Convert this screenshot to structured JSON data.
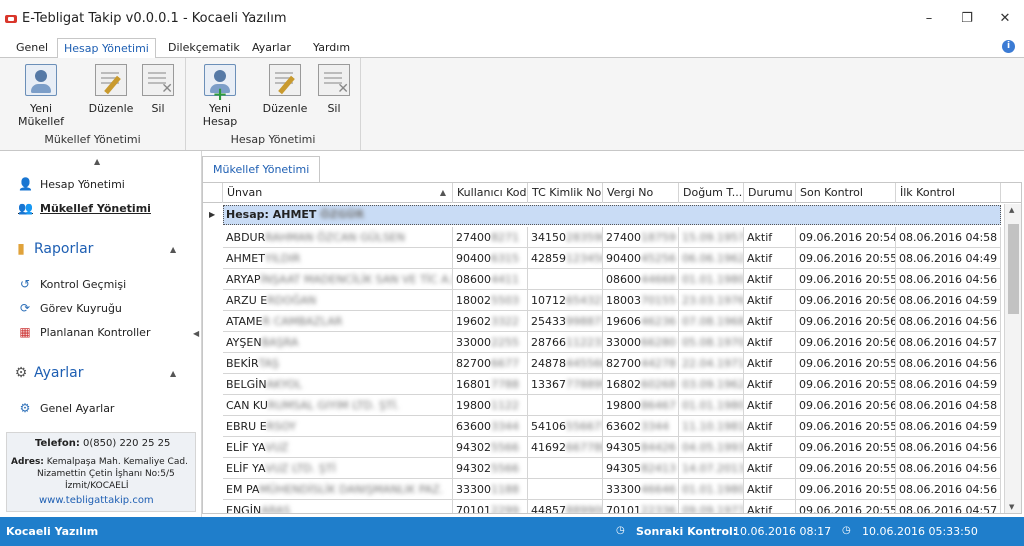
{
  "window": {
    "title": "E-Tebligat Takip v0.0.0.1 - Kocaeli Yazılım",
    "min": "–",
    "max": "❐",
    "close": "✕"
  },
  "menu": {
    "tabs": [
      "Genel",
      "Hesap Yönetimi",
      "Dilekçematik",
      "Ayarlar",
      "Yardım"
    ],
    "active": "Hesap Yönetimi"
  },
  "ribbon": {
    "group1": {
      "label": "Mükellef Yönetimi",
      "buttons": [
        "Yeni Mükellef",
        "Düzenle",
        "Sil"
      ]
    },
    "group2": {
      "label": "Hesap Yönetimi",
      "buttons": [
        "Yeni Hesap",
        "Düzenle",
        "Sil"
      ]
    }
  },
  "sidebar": {
    "items_top": [
      "Hesap Yönetimi",
      "Mükellef Yönetimi"
    ],
    "section_reports": "Raporlar",
    "reports": [
      "Kontrol Geçmişi",
      "Görev Kuyruğu",
      "Planlanan Kontroller"
    ],
    "section_settings": "Ayarlar",
    "settings": [
      "Genel Ayarlar"
    ],
    "contact": {
      "phone_label": "Telefon:",
      "phone": "0(850) 220 25 25",
      "address_label": "Adres:",
      "address1": "Kemalpaşa Mah. Kemaliye Cad.",
      "address2": "Nizamettin Çetin İşhanı No:5/5",
      "address3": "İzmit/KOCAELİ",
      "web": "www.tebligattakip.com"
    }
  },
  "content": {
    "tab": "Mükellef Yönetimi",
    "columns": [
      "Ünvan",
      "Kullanıcı Kodu",
      "TC Kimlik No",
      "Vergi No",
      "Doğum T...",
      "Durumu",
      "Son Kontrol",
      "İlk Kontrol"
    ],
    "group_label": "Hesap: AHMET",
    "group_hidden": "ÖZGÜR",
    "rows": [
      {
        "u": "ABDUR",
        "ub": "RAHMAN ÖZCAN GÜLSEN",
        "k": "27400",
        "kb": "8271",
        "t": "34150",
        "tb": "283590",
        "v": "27400",
        "vb": "18759",
        "d": "",
        "db": "15.09.",
        "d2": "1957",
        "s": "Aktif",
        "son": "09.06.2016 20:54",
        "ilk": "08.06.2016 04:58"
      },
      {
        "u": "AHMET",
        "ub": "YILDIR",
        "k": "90400",
        "kb": "6315",
        "t": "42859",
        "tb": "123456",
        "v": "90400",
        "vb": "45256",
        "d": "",
        "db": "06.06.",
        "d2": "1962",
        "s": "Aktif",
        "son": "09.06.2016 20:55",
        "ilk": "08.06.2016 04:49"
      },
      {
        "u": "ARYAP",
        "ub": "İNŞAAT MADENCİLİK SAN VE TİC A.Ş",
        "k": "08600",
        "kb": "4411",
        "t": "",
        "tb": "",
        "v": "08600",
        "vb": "44668",
        "d": "",
        "db": "01.01.",
        "d2": "1980",
        "s": "Aktif",
        "son": "09.06.2016 20:55",
        "ilk": "08.06.2016 04:56"
      },
      {
        "u": "ARZU E",
        "ub": "RDOĞAN",
        "k": "18002",
        "kb": "5503",
        "t": "10712",
        "tb": "654321",
        "v": "18003",
        "vb": "70155",
        "d": "",
        "db": "23.03.",
        "d2": "1976",
        "s": "Aktif",
        "son": "09.06.2016 20:56",
        "ilk": "08.06.2016 04:59"
      },
      {
        "u": "ATAME",
        "ub": "R CAMBAZLAR",
        "k": "19602",
        "kb": "3322",
        "t": "25433",
        "tb": "998877",
        "v": "19606",
        "vb": "46236",
        "d": "",
        "db": "07.08.",
        "d2": "1968",
        "s": "Aktif",
        "son": "09.06.2016 20:56",
        "ilk": "08.06.2016 04:56"
      },
      {
        "u": "AYŞEN",
        "ub": "BAŞRA",
        "k": "33000",
        "kb": "2255",
        "t": "28766",
        "tb": "112233",
        "v": "33000",
        "vb": "66280",
        "d": "",
        "db": "05.08.",
        "d2": "1970",
        "s": "Aktif",
        "son": "09.06.2016 20:56",
        "ilk": "08.06.2016 04:57"
      },
      {
        "u": "BEKİR",
        "ub": "TAŞ",
        "k": "82700",
        "kb": "6677",
        "t": "24878",
        "tb": "445566",
        "v": "82700",
        "vb": "44278",
        "d": "",
        "db": "22.04.",
        "d2": "1971",
        "s": "Aktif",
        "son": "09.06.2016 20:55",
        "ilk": "08.06.2016 04:56"
      },
      {
        "u": "BELGİN",
        "ub": " AKYOL",
        "k": "16801",
        "kb": "7788",
        "t": "13367",
        "tb": "778899",
        "v": "16802",
        "vb": "60268",
        "d": "",
        "db": "03.09.",
        "d2": "1962",
        "s": "Aktif",
        "son": "09.06.2016 20:55",
        "ilk": "08.06.2016 04:59"
      },
      {
        "u": "CAN KU",
        "ub": "RUMSAL GIYIM LTD. ŞTİ.",
        "k": "19800",
        "kb": "1122",
        "t": "",
        "tb": "",
        "v": "19800",
        "vb": "86467",
        "d": "",
        "db": "01.01.",
        "d2": "1980",
        "s": "Aktif",
        "son": "09.06.2016 20:56",
        "ilk": "08.06.2016 04:58"
      },
      {
        "u": "EBRU E",
        "ub": "RSOY",
        "k": "63600",
        "kb": "3344",
        "t": "54106",
        "tb": "556677",
        "v": "63602",
        "vb": "3344",
        "d": "",
        "db": "11.10.",
        "d2": "1981",
        "s": "Aktif",
        "son": "09.06.2016 20:55",
        "ilk": "08.06.2016 04:59"
      },
      {
        "u": "ELİF YA",
        "ub": "VUZ",
        "k": "94302",
        "kb": "5566",
        "t": "41692",
        "tb": "667788",
        "v": "94305",
        "vb": "84426",
        "d": "",
        "db": "04.05.",
        "d2": "1993",
        "s": "Aktif",
        "son": "09.06.2016 20:55",
        "ilk": "08.06.2016 04:56"
      },
      {
        "u": "ELİF YA",
        "ub": "VUZ LTD. ŞTİ",
        "k": "94302",
        "kb": "5566",
        "t": "",
        "tb": "",
        "v": "94305",
        "vb": "82413",
        "d": "",
        "db": "14.07.",
        "d2": "2013",
        "s": "Aktif",
        "son": "09.06.2016 20:55",
        "ilk": "08.06.2016 04:56"
      },
      {
        "u": "EM PA",
        "ub": " MÜHENDİSLİK DANIŞMANLIK PAZ.",
        "k": "33300",
        "kb": "1188",
        "t": "",
        "tb": "",
        "v": "33300",
        "vb": "46646",
        "d": "",
        "db": "01.01.",
        "d2": "1980",
        "s": "Aktif",
        "son": "09.06.2016 20:55",
        "ilk": "08.06.2016 04:56"
      },
      {
        "u": "ENGİN",
        "ub": " ARAS",
        "k": "70101",
        "kb": "2299",
        "t": "44857",
        "tb": "889900",
        "v": "70101",
        "vb": "22336",
        "d": "",
        "db": "09.09.",
        "d2": "1977",
        "s": "Aktif",
        "son": "09.06.2016 20:55",
        "ilk": "08.06.2016 04:57"
      }
    ]
  },
  "status": {
    "company": "Kocaeli Yazılım",
    "next_label": "Sonraki Kontrol:",
    "next_value": "10.06.2016 08:17",
    "clock": "10.06.2016 05:33:50"
  }
}
